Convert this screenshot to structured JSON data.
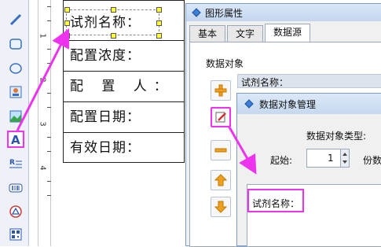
{
  "label": {
    "rows": [
      "试剂名称：",
      "配置浓度：",
      "配 置 人：",
      "配置日期：",
      "有效日期："
    ]
  },
  "ruler": {
    "marks": [
      "1",
      "2",
      "3",
      "4"
    ]
  },
  "prop_window": {
    "title": "图形属性",
    "tabs": [
      "基本",
      "文字",
      "数据源"
    ],
    "active_tab": "数据源",
    "section_label": "数据对象",
    "data_object_item": "试剂名称："
  },
  "dom_window": {
    "title": "数据对象管理",
    "type_label": "数据对象类型:",
    "start_label": "起始:",
    "start_value": "1",
    "copies_label": "份数",
    "list_value": "试剂名称："
  },
  "toolbar": {
    "icons": [
      "line-icon",
      "rect-icon",
      "ellipse-icon",
      "image-icon",
      "picture-icon",
      "text-icon",
      "rich-text-icon",
      "barcode-icon",
      "shape-icon",
      "qrcode-icon",
      "qr-square-icon"
    ]
  },
  "colors": {
    "highlight": "#ee33ee",
    "handle": "#ffff33",
    "titlebar": "#c4d6ee"
  }
}
